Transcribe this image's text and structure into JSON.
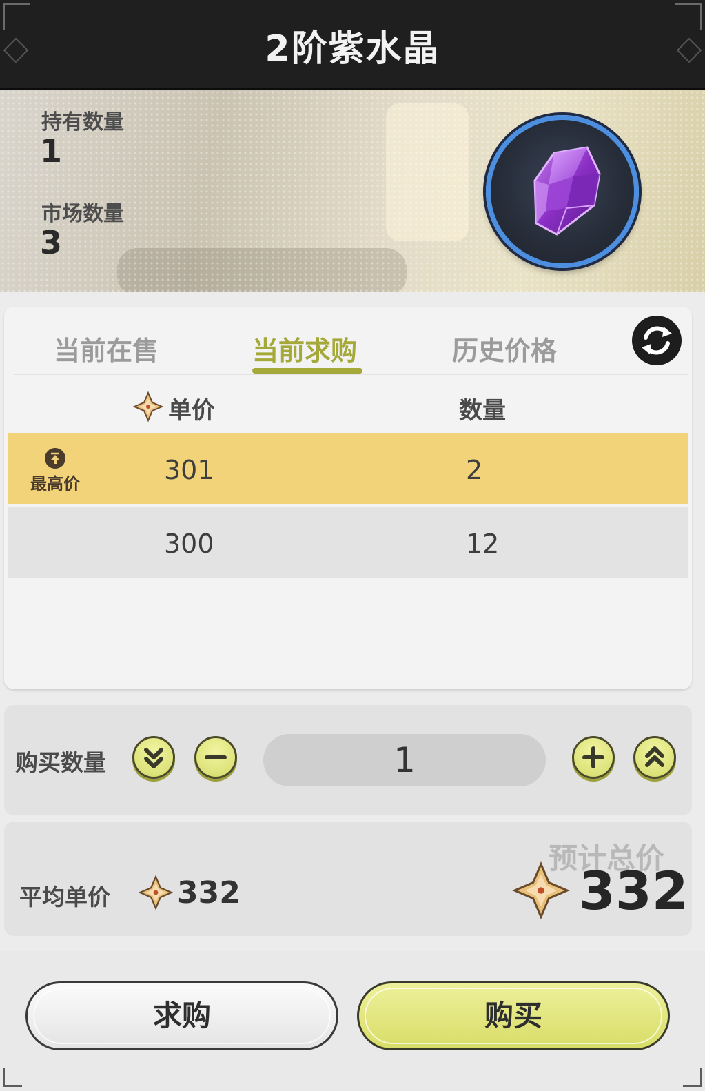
{
  "header": {
    "title": "2阶紫水晶"
  },
  "item": {
    "held_label": "持有数量",
    "held_value": "1",
    "market_label": "市场数量",
    "market_value": "3",
    "icon": "purple-crystal-icon",
    "ring_color": "#4c8fe0"
  },
  "tabs": [
    {
      "label": "当前在售",
      "active": false
    },
    {
      "label": "当前求购",
      "active": true
    },
    {
      "label": "历史价格",
      "active": false
    }
  ],
  "table": {
    "headers": {
      "price": "单价",
      "quantity": "数量"
    },
    "top_badge": "最高价",
    "rows": [
      {
        "price": "301",
        "quantity": "2",
        "highlight": true
      },
      {
        "price": "300",
        "quantity": "12",
        "highlight": false
      }
    ]
  },
  "purchase": {
    "quantity_label": "购买数量",
    "quantity_value": "1"
  },
  "summary": {
    "avg_label": "平均单价",
    "avg_value": "332",
    "total_label": "预计总价",
    "total_value": "332"
  },
  "actions": {
    "request_label": "求购",
    "buy_label": "购买"
  },
  "colors": {
    "accent": "#a4a93a",
    "highlight_row": "#f2d37a",
    "buy_button": "#e3e77f"
  }
}
